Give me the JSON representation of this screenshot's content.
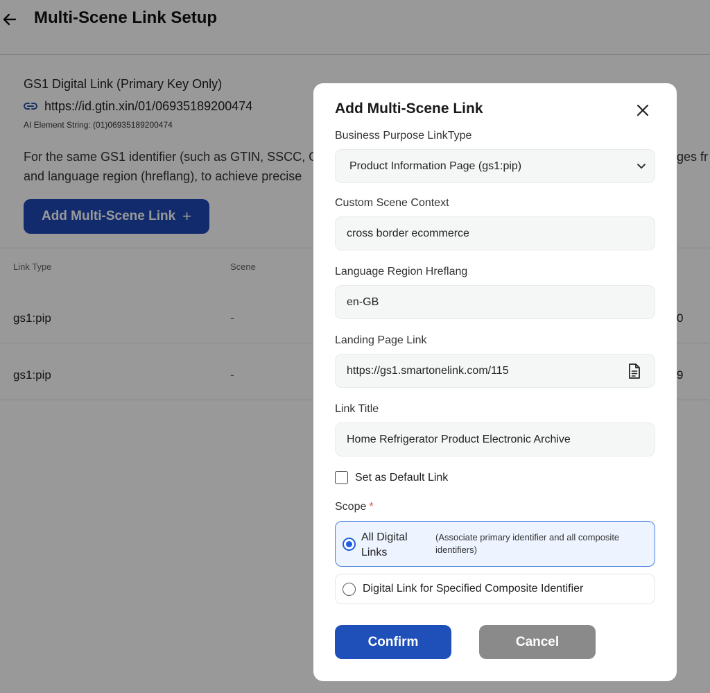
{
  "page": {
    "title": "Multi-Scene Link Setup",
    "gs1_title": "GS1 Digital Link (Primary Key Only)",
    "gs1_url": "https://id.gtin.xin/01/06935189200474",
    "ai_element_string": "AI Element String: (01)06935189200474",
    "description_line1": "For the same GS1 identifier (such as GTIN, SSCC, G",
    "description_line1_tail": "ges fr",
    "description_line2": "and language region (hreflang), to achieve precise",
    "add_button_label": "Add Multi-Scene Link",
    "add_button_icon": "+"
  },
  "table": {
    "headers": [
      "Link Type",
      "Scene"
    ],
    "rows": [
      {
        "link_type": "gs1:pip",
        "scene": "-",
        "tail": "0"
      },
      {
        "link_type": "gs1:pip",
        "scene": "-",
        "tail": "9"
      }
    ]
  },
  "modal": {
    "title": "Add Multi-Scene Link",
    "business_purpose_label": "Business Purpose LinkType",
    "business_purpose_value": "Product Information Page (gs1:pip)",
    "scene_context_label": "Custom Scene Context",
    "scene_context_value": "cross border ecommerce",
    "hreflang_label": "Language Region Hreflang",
    "hreflang_value": "en-GB",
    "landing_label": "Landing Page Link",
    "landing_value": "https://gs1.smartonelink.com/115",
    "link_title_label": "Link Title",
    "link_title_value": "Home Refrigerator Product Electronic Archive",
    "default_checkbox_label": "Set as Default Link",
    "default_checked": false,
    "scope_label": "Scope",
    "scope_required_mark": "*",
    "scope_options": [
      {
        "title": "All Digital Links",
        "note": "(Associate primary identifier and all composite identifiers)",
        "selected": true
      },
      {
        "title": "Digital Link for Specified Composite Identifier",
        "selected": false
      }
    ],
    "confirm_label": "Confirm",
    "cancel_label": "Cancel"
  },
  "colors": {
    "primary": "#1f4fb8",
    "cancel": "#8a8a8a",
    "selected_bg": "#edf4ff",
    "required": "#e24a3b"
  }
}
